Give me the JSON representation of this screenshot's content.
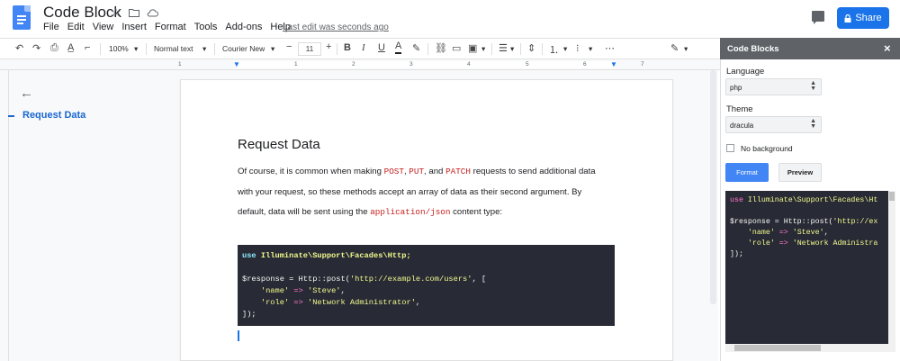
{
  "header": {
    "title": "Code Block",
    "menu": [
      "File",
      "Edit",
      "View",
      "Insert",
      "Format",
      "Tools",
      "Add-ons",
      "Help"
    ],
    "last_edit": "Last edit was seconds ago",
    "share_label": "Share",
    "share_color": "#1a73e8"
  },
  "toolbar": {
    "zoom": "100%",
    "style": "Normal text",
    "font": "Courier New",
    "font_size": "11"
  },
  "ruler": {
    "numbers": [
      "1",
      "1",
      "2",
      "3",
      "4",
      "5",
      "6",
      "7"
    ]
  },
  "outline": {
    "item": "Request Data"
  },
  "document": {
    "heading": "Request Data",
    "para1_a": "Of course, it is common when making ",
    "post": "POST",
    "sep1": ", ",
    "put": "PUT",
    "sep2": ", and ",
    "patch": "PATCH",
    "para1_b": " requests to send additional data",
    "para2": "with your request, so these methods accept an array of data as their second argument. By",
    "para3_a": "default, data will be sent using the ",
    "app_json": "application/json",
    "para3_b": " content type:",
    "code": {
      "l1_use": "use",
      "l1_ns": "Illuminate\\Support\\Facades\\Http",
      "l1_end": ";",
      "l3_a": "$response = Http::post(",
      "l3_url": "'http://example.com/users'",
      "l3_b": ", [",
      "l4_indent": "    ",
      "l4_key": "'name'",
      "l4_arrow": " => ",
      "l4_val": "'Steve'",
      "l4_end": ",",
      "l5_key": "'role'",
      "l5_val": "'Network Administrator'",
      "l6": "]);"
    }
  },
  "panel": {
    "title": "Code Blocks",
    "language_label": "Language",
    "language_value": "php",
    "theme_label": "Theme",
    "theme_value": "dracula",
    "no_background_label": "No background",
    "format_label": "Format",
    "preview_label": "Preview",
    "preview": {
      "l1_use": "use",
      "l1_ns": " Illuminate\\Support\\Facades\\Ht",
      "l3_a": "$response = Http::post(",
      "l3_url": "'http://ex",
      "l4_key": "'name'",
      "l4_val": "'Steve'",
      "l5_key": "'role'",
      "l5_val": "'Network Administra",
      "l6": "]);"
    }
  }
}
